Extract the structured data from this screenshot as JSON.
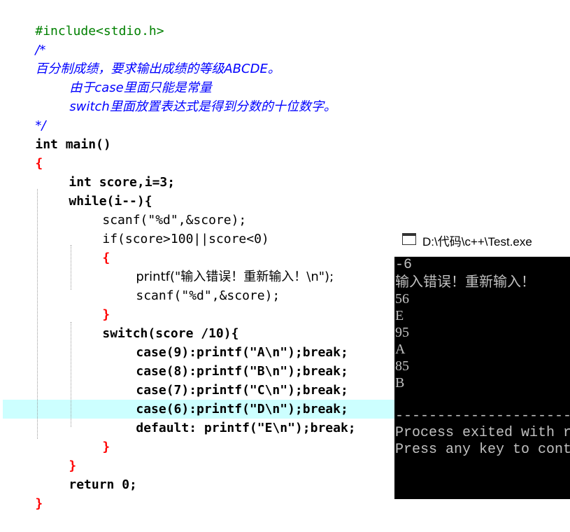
{
  "editor": {
    "lines": [
      "#include<stdio.h>",
      "/*",
      "百分制成绩，要求输出成绩的等级ABCDE。",
      "由于case里面只能是常量",
      "switch里面放置表达式是得到分数的十位数字。",
      "*/",
      "int main()",
      "{",
      "int score,i=3;",
      "while(i--){",
      "scanf(\"%d\",&score);",
      "if(score>100||score<0)",
      "{",
      "printf(\"输入错误！重新输入！\\n\");",
      "scanf(\"%d\",&score);",
      "}",
      "switch(score /10){",
      "case(9):printf(\"A\\n\");break;",
      "case(8):printf(\"B\\n\");break;",
      "case(7):printf(\"C\\n\");break;",
      "case(6):printf(\"D\\n\");break;",
      "default: printf(\"E\\n\");break;",
      "}",
      "}",
      "return 0;",
      "}"
    ]
  },
  "console": {
    "title": "D:\\代码\\c++\\Test.exe",
    "output": [
      "-6",
      "输入错误！重新输入！",
      "56",
      "E",
      "95",
      "A",
      "85",
      "B",
      "",
      "--------------------------------",
      "Process exited with r",
      "Press any key to cont"
    ]
  },
  "colors": {
    "preprocessor": "#008000",
    "comment": "#0000ff",
    "bracket": "#ff0000",
    "number": "#800080",
    "string": "#0000ff",
    "highlight": "#ccffff",
    "console_bg": "#000000",
    "console_fg": "#c0c0c0"
  }
}
